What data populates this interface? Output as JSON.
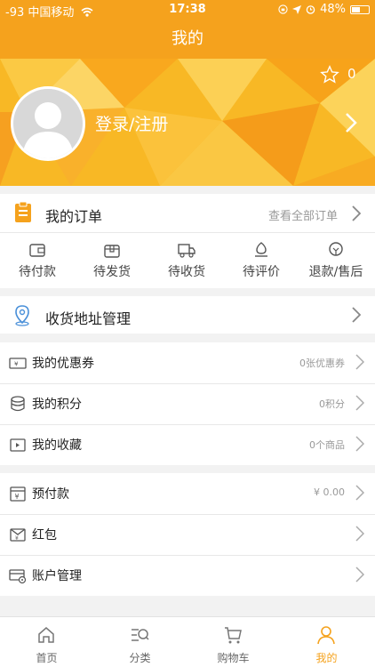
{
  "status_bar": {
    "signal": "-93 中国移动",
    "wifi_icon": "wifi-icon",
    "time": "17:38",
    "battery": "48%"
  },
  "navbar": {
    "title": "我的"
  },
  "profile": {
    "favorites_count": "0",
    "login_text": "登录/注册"
  },
  "orders": {
    "title": "我的订单",
    "view_all": "查看全部订单",
    "statuses": [
      {
        "label": "待付款",
        "icon": "wallet-icon"
      },
      {
        "label": "待发货",
        "icon": "package-icon"
      },
      {
        "label": "待收货",
        "icon": "truck-icon"
      },
      {
        "label": "待评价",
        "icon": "review-icon"
      },
      {
        "label": "退款/售后",
        "icon": "refund-icon"
      }
    ]
  },
  "address": {
    "label": "收货地址管理"
  },
  "assets": [
    {
      "label": "我的优惠券",
      "value": "0张优惠券",
      "icon": "coupon-icon"
    },
    {
      "label": "我的积分",
      "value": "0积分",
      "icon": "points-icon"
    },
    {
      "label": "我的收藏",
      "value": "0个商品",
      "icon": "favorites-icon"
    }
  ],
  "finance": [
    {
      "label": "预付款",
      "value": "¥ 0.00",
      "icon": "prepaid-icon"
    },
    {
      "label": "红包",
      "value": "",
      "icon": "red-packet-icon"
    },
    {
      "label": "账户管理",
      "value": "",
      "icon": "account-icon"
    }
  ],
  "tabbar": [
    {
      "label": "首页",
      "icon": "home-icon"
    },
    {
      "label": "分类",
      "icon": "category-icon"
    },
    {
      "label": "购物车",
      "icon": "cart-icon"
    },
    {
      "label": "我的",
      "icon": "user-icon",
      "active": true
    }
  ],
  "colors": {
    "accent": "#f5a21d",
    "background": "#f2f2f2"
  }
}
